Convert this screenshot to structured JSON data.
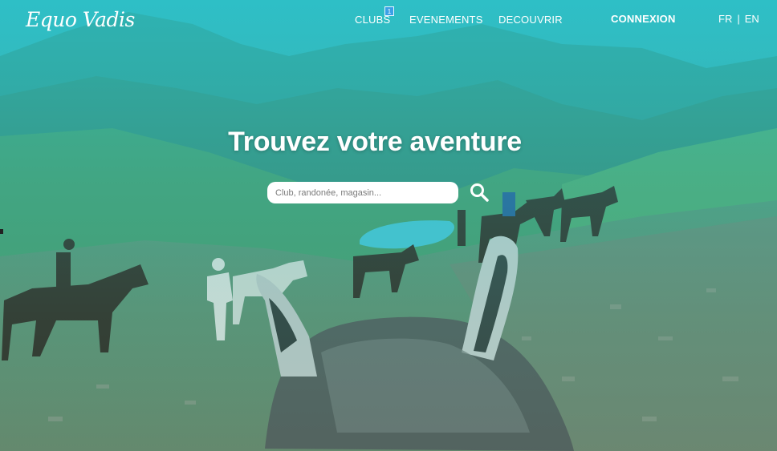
{
  "brand": {
    "logo_text": "Equo Vadis"
  },
  "nav": {
    "items": [
      {
        "label": "CLUBS"
      },
      {
        "label": "EVENEMENTS"
      },
      {
        "label": "DECOUVRIR"
      }
    ],
    "clubs_badge": "1",
    "login_label": "CONNEXION"
  },
  "language": {
    "fr": "FR",
    "separator": "|",
    "en": "EN"
  },
  "hero": {
    "title": "Trouvez votre aventure",
    "search_placeholder": "Club, randonée, magasin...",
    "search_icon": "magnifier-icon"
  },
  "colors": {
    "tint": "#23c8d2",
    "text": "#ffffff",
    "badge": "#3aa0e6"
  }
}
